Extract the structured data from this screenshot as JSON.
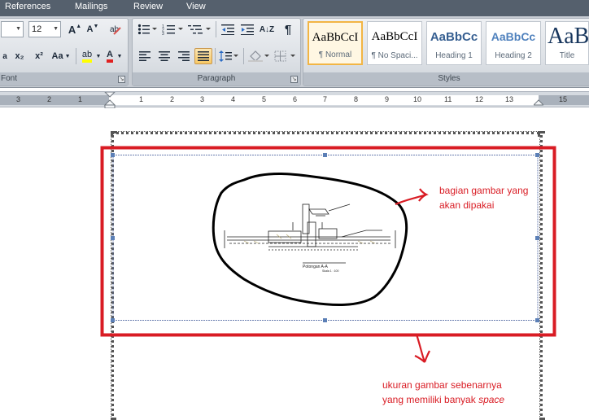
{
  "tabs": [
    "References",
    "Mailings",
    "Review",
    "View"
  ],
  "font_group": {
    "label": "Font",
    "font_size": "12",
    "grow_font": "A",
    "shrink_font": "A",
    "subscript": "x₂",
    "superscript": "x²",
    "change_case": "Aa",
    "highlight": "ab",
    "font_color": "A",
    "clear_format": "✕"
  },
  "paragraph_group": {
    "label": "Paragraph",
    "show_marks": "¶",
    "sort": "A↓Z"
  },
  "styles_group": {
    "label": "Styles",
    "items": [
      {
        "preview": "AaBbCcI",
        "name": "¶ Normal"
      },
      {
        "preview": "AaBbCcI",
        "name": "¶ No Spaci..."
      },
      {
        "preview": "AaBbCc",
        "name": "Heading 1"
      },
      {
        "preview": "AaBbCc",
        "name": "Heading 2"
      },
      {
        "preview": "AaB",
        "name": "Title"
      }
    ]
  },
  "ruler": {
    "numbers_left": [
      "3",
      "2",
      "1"
    ],
    "numbers_right": [
      "1",
      "2",
      "3",
      "4",
      "5",
      "6",
      "7",
      "8",
      "9",
      "10",
      "11",
      "12",
      "13",
      "15"
    ]
  },
  "annotations": {
    "used_part_line1": "bagian gambar yang",
    "used_part_line2": "akan dipakai",
    "actual_size_line1": "ukuran gambar sebenarnya",
    "actual_size_line2": "yang memiliki banyak ",
    "actual_size_italic": "space"
  },
  "drawing": {
    "section_title": "Potongan A-A",
    "scale": "Skala 1 : 100"
  },
  "colors": {
    "annotation_red": "#d91c24",
    "tab_bar": "#55606d",
    "selected_style_border": "#f2b544"
  }
}
